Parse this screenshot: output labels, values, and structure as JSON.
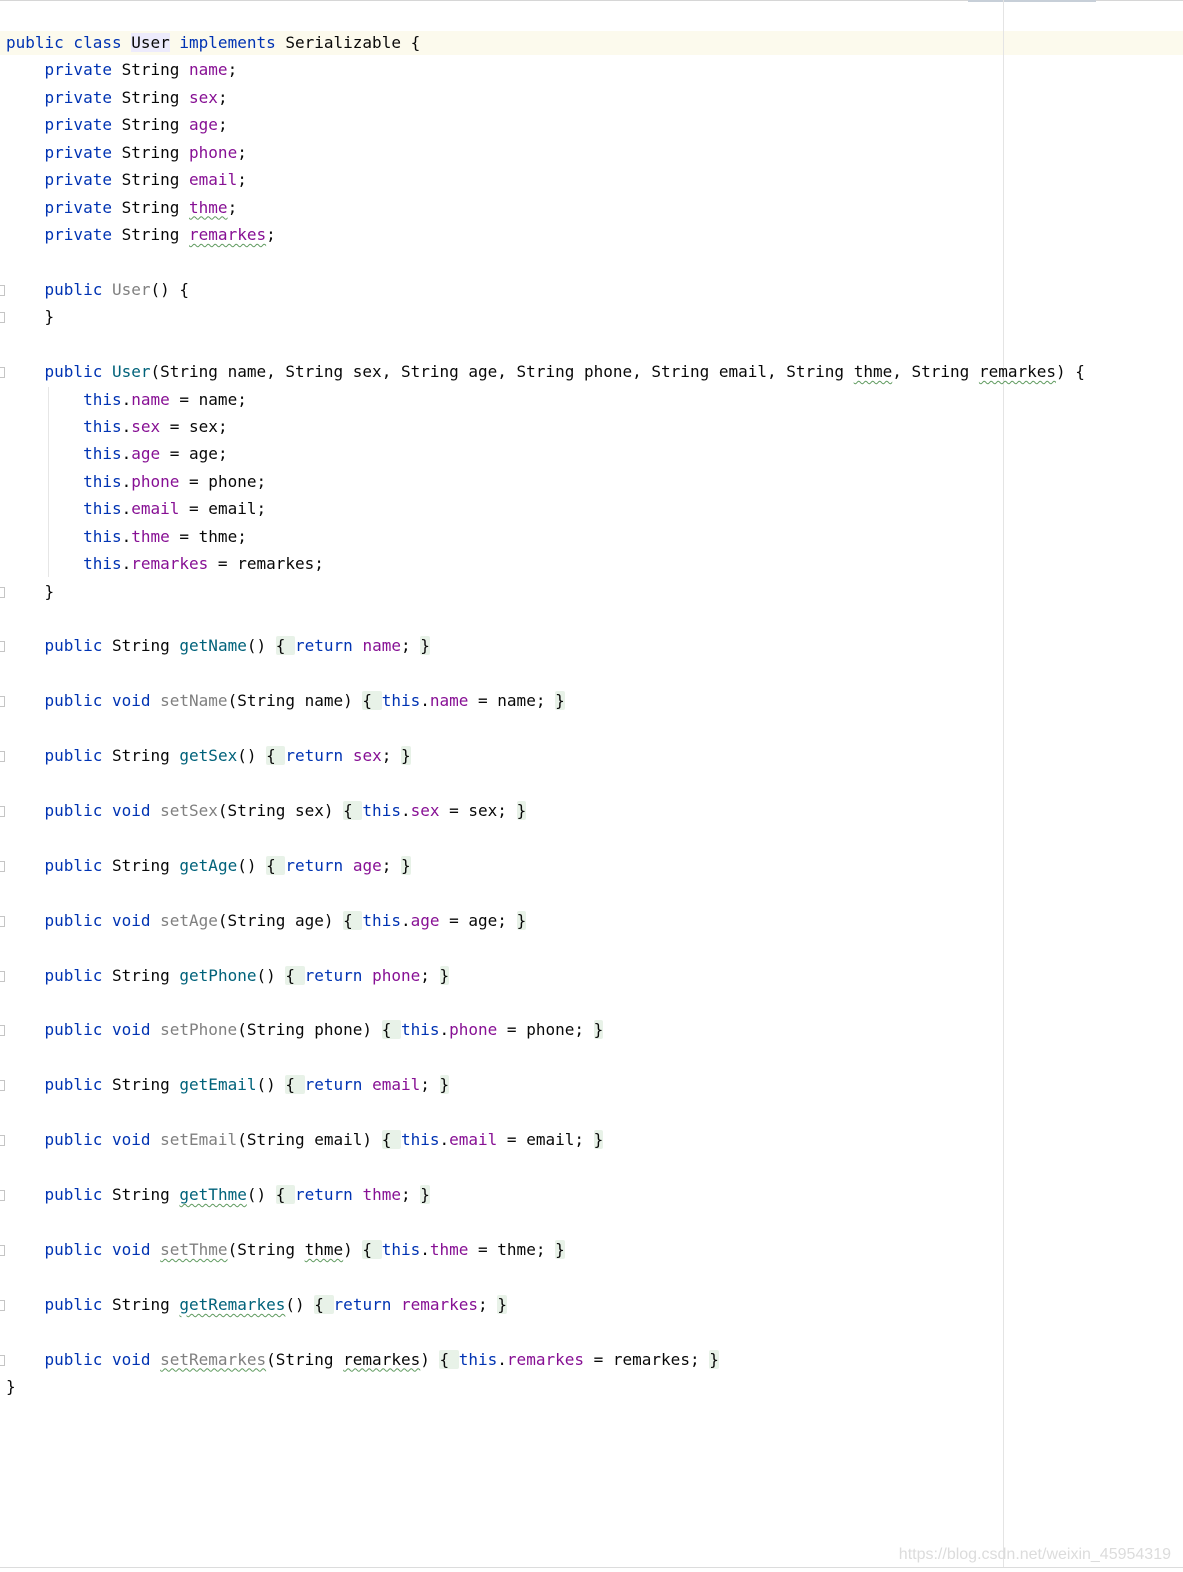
{
  "editor": {
    "language": "Java",
    "lines": [
      {
        "tokens": [
          {
            "t": "public class ",
            "c": "kw"
          },
          {
            "t": "User",
            "c": "hl"
          },
          {
            "t": " implements ",
            "c": "kw"
          },
          {
            "t": "Serializable {",
            "c": ""
          }
        ]
      },
      {
        "tokens": [
          {
            "t": "    private ",
            "c": "kw"
          },
          {
            "t": "String ",
            "c": ""
          },
          {
            "t": "name",
            "c": "fld"
          },
          {
            "t": ";",
            "c": ""
          }
        ]
      },
      {
        "tokens": [
          {
            "t": "    private ",
            "c": "kw"
          },
          {
            "t": "String ",
            "c": ""
          },
          {
            "t": "sex",
            "c": "fld"
          },
          {
            "t": ";",
            "c": ""
          }
        ]
      },
      {
        "tokens": [
          {
            "t": "    private ",
            "c": "kw"
          },
          {
            "t": "String ",
            "c": ""
          },
          {
            "t": "age",
            "c": "fld"
          },
          {
            "t": ";",
            "c": ""
          }
        ]
      },
      {
        "tokens": [
          {
            "t": "    private ",
            "c": "kw"
          },
          {
            "t": "String ",
            "c": ""
          },
          {
            "t": "phone",
            "c": "fld"
          },
          {
            "t": ";",
            "c": ""
          }
        ]
      },
      {
        "tokens": [
          {
            "t": "    private ",
            "c": "kw"
          },
          {
            "t": "String ",
            "c": ""
          },
          {
            "t": "email",
            "c": "fld"
          },
          {
            "t": ";",
            "c": ""
          }
        ]
      },
      {
        "tokens": [
          {
            "t": "    private ",
            "c": "kw"
          },
          {
            "t": "String ",
            "c": ""
          },
          {
            "t": "thme",
            "c": "fld typo"
          },
          {
            "t": ";",
            "c": ""
          }
        ]
      },
      {
        "tokens": [
          {
            "t": "    private ",
            "c": "kw"
          },
          {
            "t": "String ",
            "c": ""
          },
          {
            "t": "remarkes",
            "c": "fld typo"
          },
          {
            "t": ";",
            "c": ""
          }
        ]
      },
      {
        "tokens": []
      },
      {
        "tokens": [
          {
            "t": "    public ",
            "c": "kw"
          },
          {
            "t": "User",
            "c": "unused"
          },
          {
            "t": "() {",
            "c": ""
          }
        ]
      },
      {
        "tokens": [
          {
            "t": "    }",
            "c": ""
          }
        ]
      },
      {
        "tokens": []
      },
      {
        "tokens": [
          {
            "t": "    public ",
            "c": "kw"
          },
          {
            "t": "User",
            "c": "mth"
          },
          {
            "t": "(String name, String sex, String age, String phone, String email, String ",
            "c": ""
          },
          {
            "t": "thme",
            "c": "typo"
          },
          {
            "t": ", String ",
            "c": ""
          },
          {
            "t": "remarkes",
            "c": "typo"
          },
          {
            "t": ") {",
            "c": ""
          }
        ]
      },
      {
        "tokens": [
          {
            "t": "        this",
            "c": "kw"
          },
          {
            "t": ".",
            "c": ""
          },
          {
            "t": "name",
            "c": "fld"
          },
          {
            "t": " = name;",
            "c": ""
          }
        ]
      },
      {
        "tokens": [
          {
            "t": "        this",
            "c": "kw"
          },
          {
            "t": ".",
            "c": ""
          },
          {
            "t": "sex",
            "c": "fld"
          },
          {
            "t": " = sex;",
            "c": ""
          }
        ]
      },
      {
        "tokens": [
          {
            "t": "        this",
            "c": "kw"
          },
          {
            "t": ".",
            "c": ""
          },
          {
            "t": "age",
            "c": "fld"
          },
          {
            "t": " = age;",
            "c": ""
          }
        ]
      },
      {
        "tokens": [
          {
            "t": "        this",
            "c": "kw"
          },
          {
            "t": ".",
            "c": ""
          },
          {
            "t": "phone",
            "c": "fld"
          },
          {
            "t": " = phone;",
            "c": ""
          }
        ]
      },
      {
        "tokens": [
          {
            "t": "        this",
            "c": "kw"
          },
          {
            "t": ".",
            "c": ""
          },
          {
            "t": "email",
            "c": "fld"
          },
          {
            "t": " = email;",
            "c": ""
          }
        ]
      },
      {
        "tokens": [
          {
            "t": "        this",
            "c": "kw"
          },
          {
            "t": ".",
            "c": ""
          },
          {
            "t": "thme",
            "c": "fld"
          },
          {
            "t": " = thme;",
            "c": ""
          }
        ]
      },
      {
        "tokens": [
          {
            "t": "        this",
            "c": "kw"
          },
          {
            "t": ".",
            "c": ""
          },
          {
            "t": "remarkes",
            "c": "fld"
          },
          {
            "t": " = remarkes;",
            "c": ""
          }
        ]
      },
      {
        "tokens": [
          {
            "t": "    }",
            "c": ""
          }
        ]
      },
      {
        "tokens": []
      },
      {
        "tokens": [
          {
            "t": "    public ",
            "c": "kw"
          },
          {
            "t": "String ",
            "c": ""
          },
          {
            "t": "getName",
            "c": "mth"
          },
          {
            "t": "() ",
            "c": ""
          },
          {
            "t": "{ ",
            "c": "fold"
          },
          {
            "t": "return ",
            "c": "kw"
          },
          {
            "t": "name",
            "c": "fld"
          },
          {
            "t": "; ",
            "c": ""
          },
          {
            "t": "}",
            "c": "fold"
          }
        ]
      },
      {
        "tokens": []
      },
      {
        "tokens": [
          {
            "t": "    public void ",
            "c": "kw"
          },
          {
            "t": "setName",
            "c": "unused"
          },
          {
            "t": "(String name) ",
            "c": ""
          },
          {
            "t": "{ ",
            "c": "fold"
          },
          {
            "t": "this",
            "c": "kw"
          },
          {
            "t": ".",
            "c": ""
          },
          {
            "t": "name",
            "c": "fld"
          },
          {
            "t": " = name; ",
            "c": ""
          },
          {
            "t": "}",
            "c": "fold"
          }
        ]
      },
      {
        "tokens": []
      },
      {
        "tokens": [
          {
            "t": "    public ",
            "c": "kw"
          },
          {
            "t": "String ",
            "c": ""
          },
          {
            "t": "getSex",
            "c": "mth"
          },
          {
            "t": "() ",
            "c": ""
          },
          {
            "t": "{ ",
            "c": "fold"
          },
          {
            "t": "return ",
            "c": "kw"
          },
          {
            "t": "sex",
            "c": "fld"
          },
          {
            "t": "; ",
            "c": ""
          },
          {
            "t": "}",
            "c": "fold"
          }
        ]
      },
      {
        "tokens": []
      },
      {
        "tokens": [
          {
            "t": "    public void ",
            "c": "kw"
          },
          {
            "t": "setSex",
            "c": "unused"
          },
          {
            "t": "(String sex) ",
            "c": ""
          },
          {
            "t": "{ ",
            "c": "fold"
          },
          {
            "t": "this",
            "c": "kw"
          },
          {
            "t": ".",
            "c": ""
          },
          {
            "t": "sex",
            "c": "fld"
          },
          {
            "t": " = sex; ",
            "c": ""
          },
          {
            "t": "}",
            "c": "fold"
          }
        ]
      },
      {
        "tokens": []
      },
      {
        "tokens": [
          {
            "t": "    public ",
            "c": "kw"
          },
          {
            "t": "String ",
            "c": ""
          },
          {
            "t": "getAge",
            "c": "mth"
          },
          {
            "t": "() ",
            "c": ""
          },
          {
            "t": "{ ",
            "c": "fold"
          },
          {
            "t": "return ",
            "c": "kw"
          },
          {
            "t": "age",
            "c": "fld"
          },
          {
            "t": "; ",
            "c": ""
          },
          {
            "t": "}",
            "c": "fold"
          }
        ]
      },
      {
        "tokens": []
      },
      {
        "tokens": [
          {
            "t": "    public void ",
            "c": "kw"
          },
          {
            "t": "setAge",
            "c": "unused"
          },
          {
            "t": "(String age) ",
            "c": ""
          },
          {
            "t": "{ ",
            "c": "fold"
          },
          {
            "t": "this",
            "c": "kw"
          },
          {
            "t": ".",
            "c": ""
          },
          {
            "t": "age",
            "c": "fld"
          },
          {
            "t": " = age; ",
            "c": ""
          },
          {
            "t": "}",
            "c": "fold"
          }
        ]
      },
      {
        "tokens": []
      },
      {
        "tokens": [
          {
            "t": "    public ",
            "c": "kw"
          },
          {
            "t": "String ",
            "c": ""
          },
          {
            "t": "getPhone",
            "c": "mth"
          },
          {
            "t": "() ",
            "c": ""
          },
          {
            "t": "{ ",
            "c": "fold"
          },
          {
            "t": "return ",
            "c": "kw"
          },
          {
            "t": "phone",
            "c": "fld"
          },
          {
            "t": "; ",
            "c": ""
          },
          {
            "t": "}",
            "c": "fold"
          }
        ]
      },
      {
        "tokens": []
      },
      {
        "tokens": [
          {
            "t": "    public void ",
            "c": "kw"
          },
          {
            "t": "setPhone",
            "c": "unused"
          },
          {
            "t": "(String phone) ",
            "c": ""
          },
          {
            "t": "{ ",
            "c": "fold"
          },
          {
            "t": "this",
            "c": "kw"
          },
          {
            "t": ".",
            "c": ""
          },
          {
            "t": "phone",
            "c": "fld"
          },
          {
            "t": " = phone; ",
            "c": ""
          },
          {
            "t": "}",
            "c": "fold"
          }
        ]
      },
      {
        "tokens": []
      },
      {
        "tokens": [
          {
            "t": "    public ",
            "c": "kw"
          },
          {
            "t": "String ",
            "c": ""
          },
          {
            "t": "getEmail",
            "c": "mth"
          },
          {
            "t": "() ",
            "c": ""
          },
          {
            "t": "{ ",
            "c": "fold"
          },
          {
            "t": "return ",
            "c": "kw"
          },
          {
            "t": "email",
            "c": "fld"
          },
          {
            "t": "; ",
            "c": ""
          },
          {
            "t": "}",
            "c": "fold"
          }
        ]
      },
      {
        "tokens": []
      },
      {
        "tokens": [
          {
            "t": "    public void ",
            "c": "kw"
          },
          {
            "t": "setEmail",
            "c": "unused"
          },
          {
            "t": "(String email) ",
            "c": ""
          },
          {
            "t": "{ ",
            "c": "fold"
          },
          {
            "t": "this",
            "c": "kw"
          },
          {
            "t": ".",
            "c": ""
          },
          {
            "t": "email",
            "c": "fld"
          },
          {
            "t": " = email; ",
            "c": ""
          },
          {
            "t": "}",
            "c": "fold"
          }
        ]
      },
      {
        "tokens": []
      },
      {
        "tokens": [
          {
            "t": "    public ",
            "c": "kw"
          },
          {
            "t": "String ",
            "c": ""
          },
          {
            "t": "getThme",
            "c": "mth typo"
          },
          {
            "t": "() ",
            "c": ""
          },
          {
            "t": "{ ",
            "c": "fold"
          },
          {
            "t": "return ",
            "c": "kw"
          },
          {
            "t": "thme",
            "c": "fld"
          },
          {
            "t": "; ",
            "c": ""
          },
          {
            "t": "}",
            "c": "fold"
          }
        ]
      },
      {
        "tokens": []
      },
      {
        "tokens": [
          {
            "t": "    public void ",
            "c": "kw"
          },
          {
            "t": "setThme",
            "c": "unused typo"
          },
          {
            "t": "(String ",
            "c": ""
          },
          {
            "t": "thme",
            "c": "typo"
          },
          {
            "t": ") ",
            "c": ""
          },
          {
            "t": "{ ",
            "c": "fold"
          },
          {
            "t": "this",
            "c": "kw"
          },
          {
            "t": ".",
            "c": ""
          },
          {
            "t": "thme",
            "c": "fld"
          },
          {
            "t": " = thme; ",
            "c": ""
          },
          {
            "t": "}",
            "c": "fold"
          }
        ]
      },
      {
        "tokens": []
      },
      {
        "tokens": [
          {
            "t": "    public ",
            "c": "kw"
          },
          {
            "t": "String ",
            "c": ""
          },
          {
            "t": "getRemarkes",
            "c": "mth typo"
          },
          {
            "t": "() ",
            "c": ""
          },
          {
            "t": "{ ",
            "c": "fold"
          },
          {
            "t": "return ",
            "c": "kw"
          },
          {
            "t": "remarkes",
            "c": "fld"
          },
          {
            "t": "; ",
            "c": ""
          },
          {
            "t": "}",
            "c": "fold"
          }
        ]
      },
      {
        "tokens": []
      },
      {
        "tokens": [
          {
            "t": "    public void ",
            "c": "kw"
          },
          {
            "t": "setRemarkes",
            "c": "unused typo"
          },
          {
            "t": "(String ",
            "c": ""
          },
          {
            "t": "remarkes",
            "c": "typo"
          },
          {
            "t": ") ",
            "c": ""
          },
          {
            "t": "{ ",
            "c": "fold"
          },
          {
            "t": "this",
            "c": "kw"
          },
          {
            "t": ".",
            "c": ""
          },
          {
            "t": "remarkes",
            "c": "fld"
          },
          {
            "t": " = remarkes; ",
            "c": ""
          },
          {
            "t": "}",
            "c": "fold"
          }
        ]
      },
      {
        "tokens": [
          {
            "t": "}",
            "c": ""
          }
        ]
      }
    ]
  },
  "watermark": "https://blog.csdn.net/weixin_45954319",
  "colors": {
    "keyword": "#0033b3",
    "field": "#871094",
    "method": "#00627a",
    "unused": "#808080",
    "caret_line": "#fcfaed",
    "fold_bg": "#e8f2e8"
  }
}
